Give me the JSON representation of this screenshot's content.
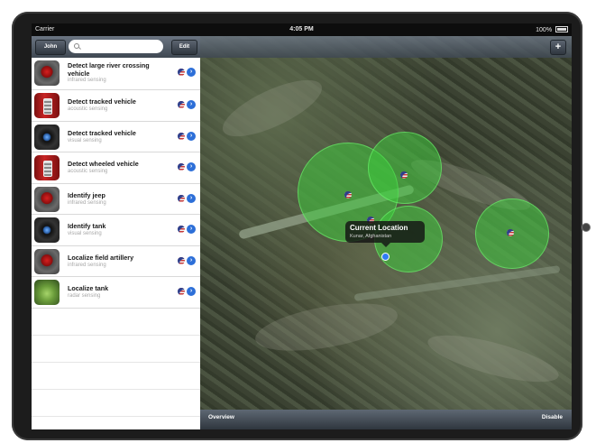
{
  "status_bar": {
    "carrier": "Carrier",
    "time": "4:05 PM",
    "battery": "100%"
  },
  "sidebar": {
    "user_button": "John",
    "search_placeholder": "",
    "edit_button": "Edit",
    "items": [
      {
        "title": "Detect large river crossing vehicle",
        "subtitle": "infrared sensing",
        "thumb": "infrared",
        "flag_icon": "us-flag-icon"
      },
      {
        "title": "Detect tracked vehicle",
        "subtitle": "acoustic sensing",
        "thumb": "acoustic",
        "flag_icon": "us-flag-icon"
      },
      {
        "title": "Detect tracked vehicle",
        "subtitle": "visual sensing",
        "thumb": "visual",
        "flag_icon": "us-flag-icon"
      },
      {
        "title": "Detect wheeled vehicle",
        "subtitle": "acoustic sensing",
        "thumb": "acoustic",
        "flag_icon": "us-flag-icon"
      },
      {
        "title": "Identify jeep",
        "subtitle": "infrared sensing",
        "thumb": "infrared",
        "flag_icon": "us-flag-icon"
      },
      {
        "title": "Identify tank",
        "subtitle": "visual sensing",
        "thumb": "visual",
        "flag_icon": "us-flag-icon"
      },
      {
        "title": "Localize field artillery",
        "subtitle": "infrared sensing",
        "thumb": "infrared",
        "flag_icon": "us-flag-icon"
      },
      {
        "title": "Localize tank",
        "subtitle": "radar sensing",
        "thumb": "radar",
        "flag_icon": "us-flag-icon"
      }
    ]
  },
  "map": {
    "add_button": "+",
    "callout": {
      "title": "Current Location",
      "subtitle": "Kunar, Afghanistan"
    },
    "bottom": {
      "left_button": "Overview",
      "right_button": "Disable"
    },
    "zone_color": "#3cd23c",
    "location_dot_color": "#2f7cf5"
  }
}
